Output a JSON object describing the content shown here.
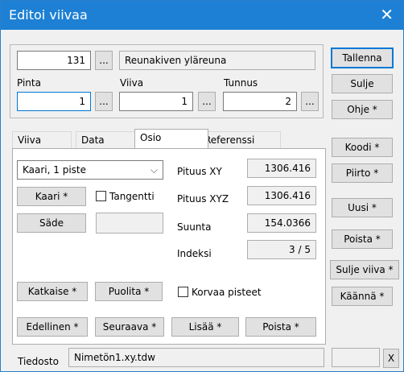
{
  "window": {
    "title": "Editoi viivaa"
  },
  "top": {
    "number": "131",
    "ellipsis": "...",
    "description": "Reunakiven yläreuna",
    "pinta_label": "Pinta",
    "pinta_value": "1",
    "viiva_label": "Viiva",
    "viiva_value": "1",
    "tunnus_label": "Tunnus",
    "tunnus_value": "2"
  },
  "side_buttons": {
    "tallenna": "Tallenna",
    "sulje": "Sulje",
    "ohje": "Ohje *",
    "koodi": "Koodi *",
    "piirto": "Piirto *",
    "uusi": "Uusi *",
    "poista": "Poista *",
    "sulje_viiva": "Sulje viiva *",
    "kaanna": "Käännä *"
  },
  "tabs": [
    "Viiva",
    "Data",
    "Osio",
    "Referenssi"
  ],
  "osio": {
    "dropdown": "Kaari, 1 piste",
    "kaari_btn": "Kaari *",
    "tangentti": "Tangentti",
    "sade_btn": "Säde",
    "pituus_xy_label": "Pituus XY",
    "pituus_xy": "1306.416",
    "pituus_xyz_label": "Pituus XYZ",
    "pituus_xyz": "1306.416",
    "suunta_label": "Suunta",
    "suunta": "154.0366",
    "indeksi_label": "Indeksi",
    "indeksi": "3 / 5",
    "katkaise": "Katkaise *",
    "puolita": "Puolita *",
    "korvaa": "Korvaa pisteet",
    "edellinen": "Edellinen *",
    "seuraava": "Seuraava *",
    "lisaa": "Lisää *",
    "poista": "Poista *"
  },
  "footer": {
    "tiedosto_label": "Tiedosto",
    "file": "Nimetön1.xy.tdw",
    "close": "X"
  },
  "colors": {
    "titlebar": "#1d80d4",
    "focus": "#0078d7"
  }
}
